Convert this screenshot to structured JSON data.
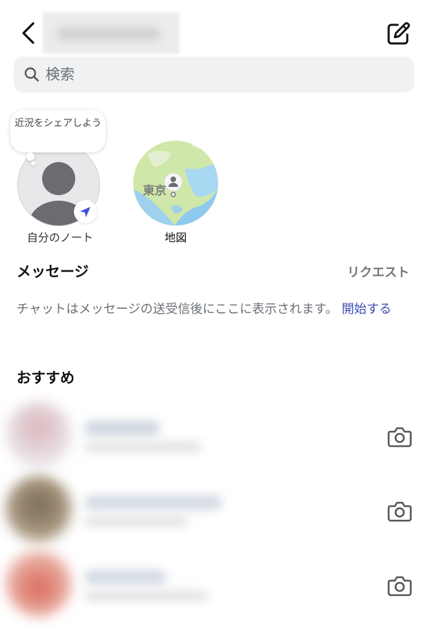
{
  "header": {
    "back_icon": "chevron-left-icon",
    "compose_icon": "edit-icon",
    "username_blurred": true
  },
  "search": {
    "placeholder": "検索",
    "value": ""
  },
  "notes": {
    "bubble_text": "近況をシェアしよう",
    "self_label": "自分のノート",
    "map_label": "地図",
    "map_city": "東京"
  },
  "messages": {
    "title": "メッセージ",
    "requests_label": "リクエスト",
    "empty_text": "チャットはメッセージの送受信後にここに表示されます。",
    "start_link": "開始する"
  },
  "suggestions": {
    "title": "おすすめ",
    "items": [
      {
        "blurred": true,
        "action_icon": "camera-icon"
      },
      {
        "blurred": true,
        "action_icon": "camera-icon"
      },
      {
        "blurred": true,
        "action_icon": "camera-icon"
      }
    ]
  },
  "colors": {
    "link": "#3a4bb5",
    "secondary_text": "#6a6f75",
    "search_bg": "#eff1f3",
    "location_arrow": "#3b4fd8"
  }
}
